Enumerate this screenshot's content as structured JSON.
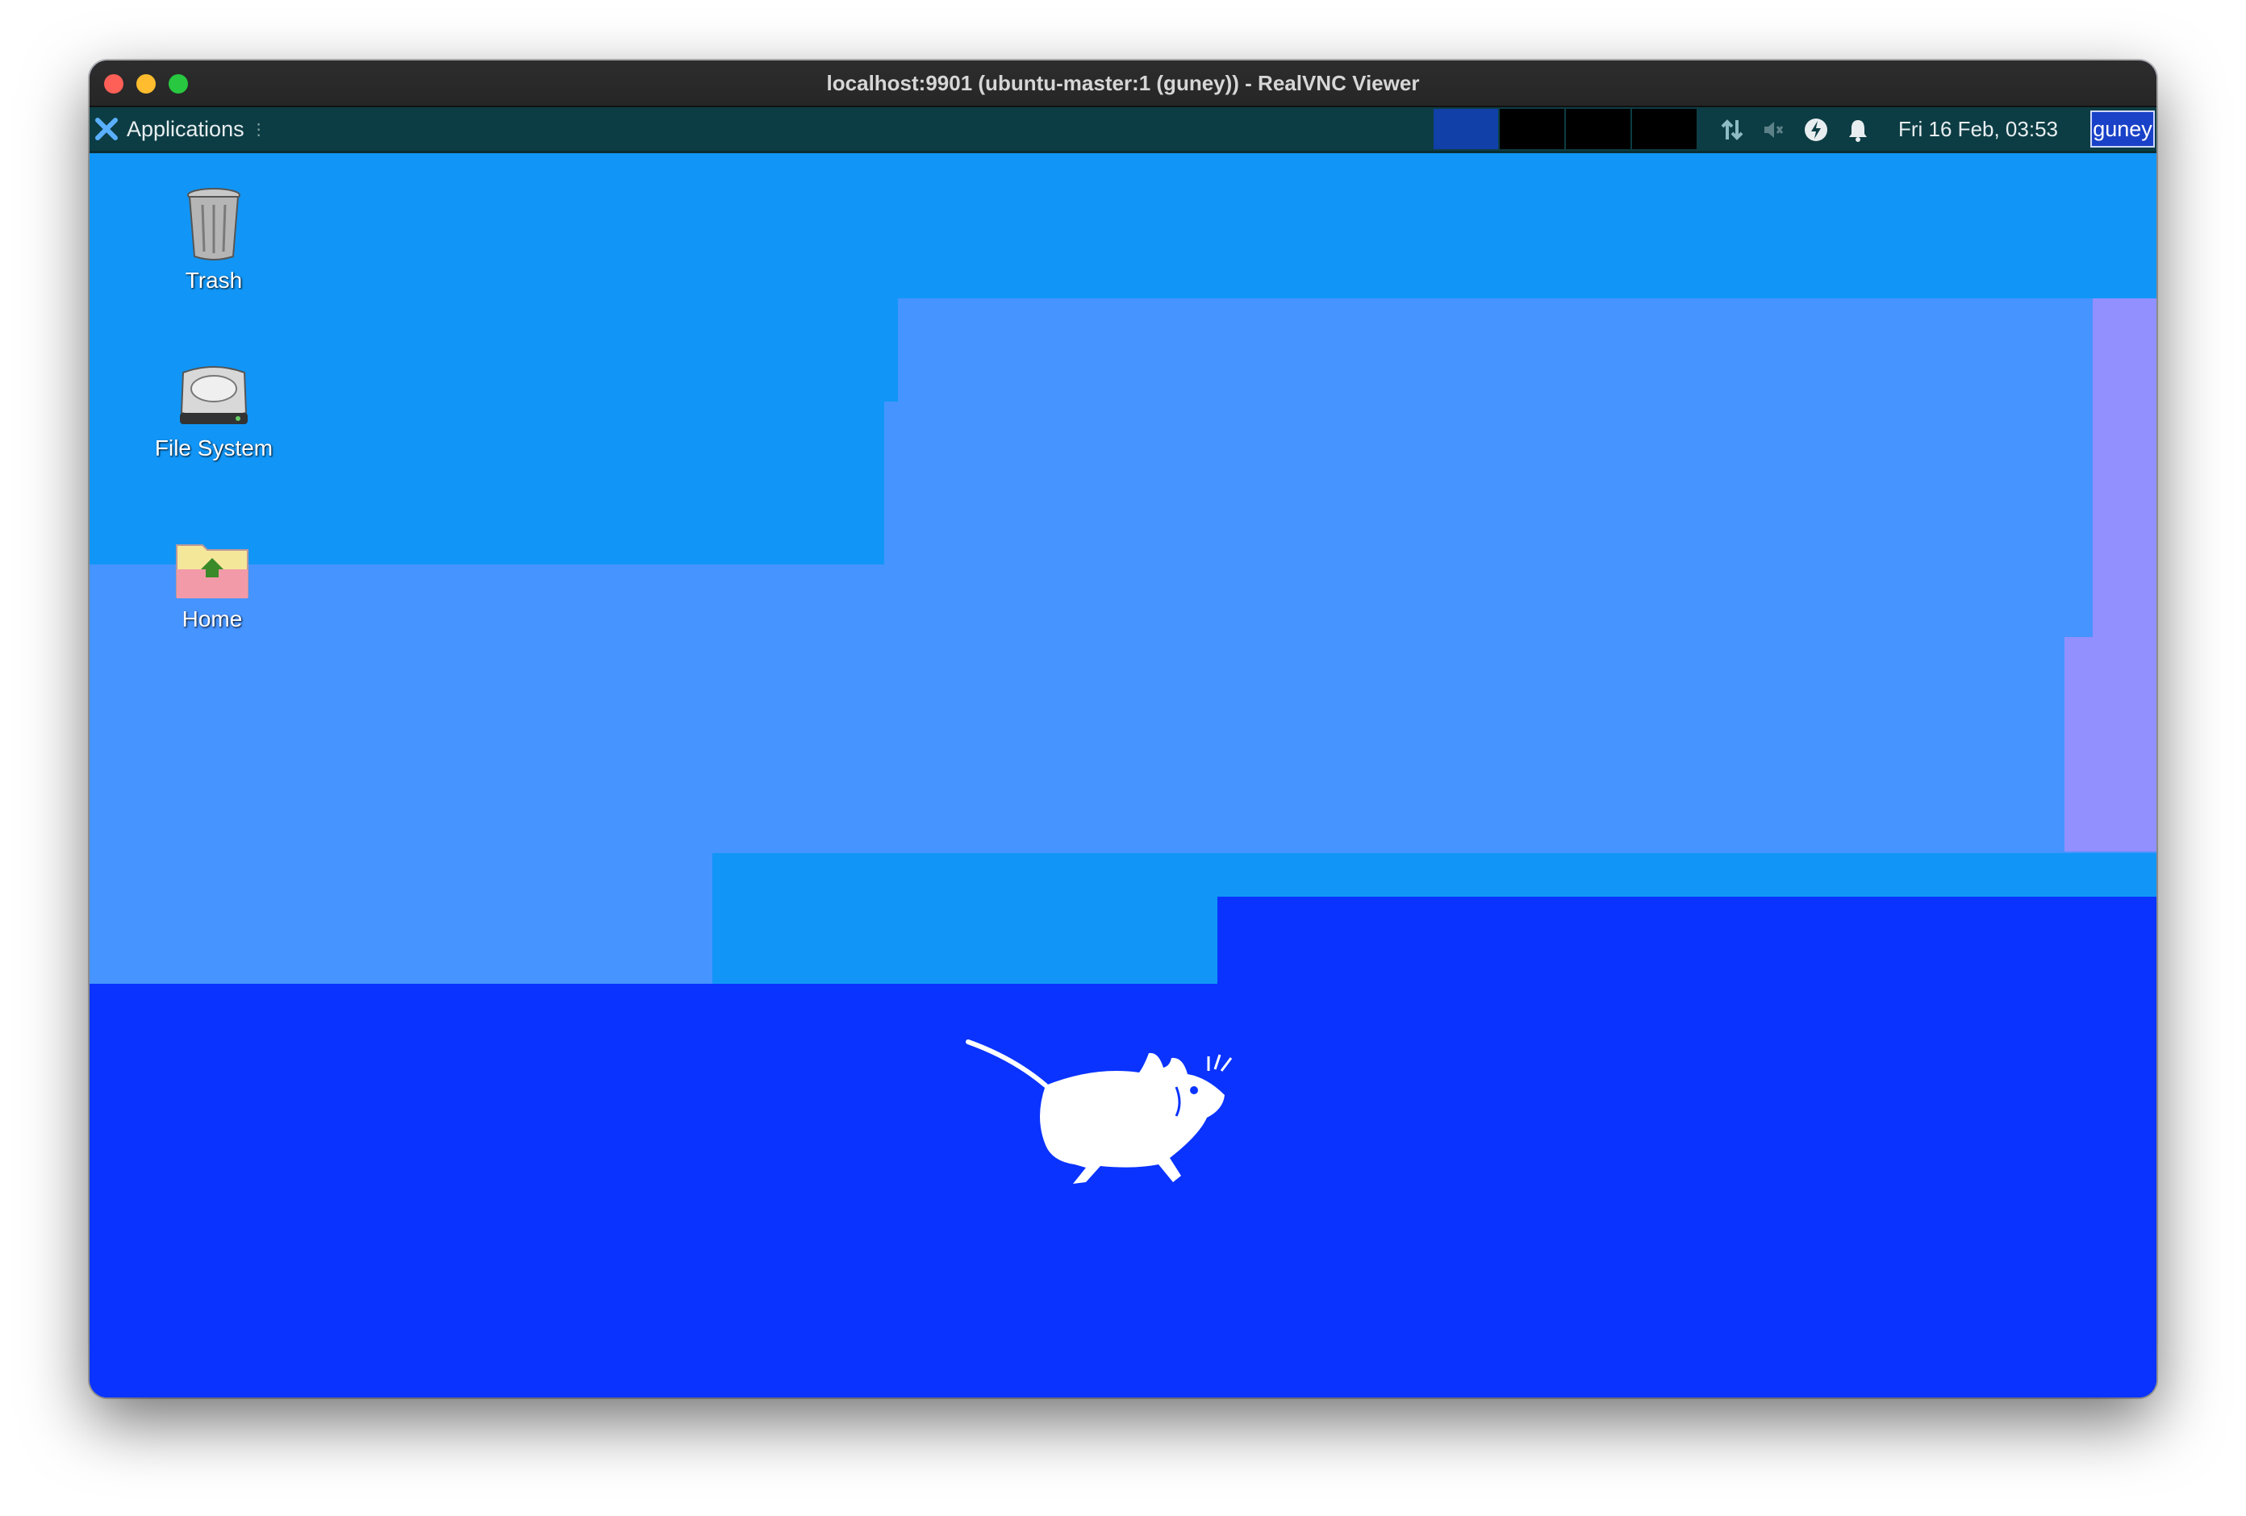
{
  "window": {
    "title": "localhost:9901 (ubuntu-master:1 (guney)) - RealVNC Viewer"
  },
  "panel": {
    "applications_label": "Applications",
    "clock": "Fri 16 Feb, 03:53",
    "user": "guney"
  },
  "desktop": {
    "icons": [
      {
        "label": "Trash"
      },
      {
        "label": "File System"
      },
      {
        "label": "Home"
      }
    ]
  },
  "dock": {
    "items": [
      "show-desktop",
      "terminal",
      "file-manager",
      "web-browser",
      "app-finder",
      "home-folder"
    ]
  },
  "colors": {
    "desktop_blue": "#0a33ff",
    "panel_bg": "#0d3d44",
    "light_blue": "#1196f7",
    "periwinkle": "#4694ff",
    "lavender": "#9290fe"
  }
}
